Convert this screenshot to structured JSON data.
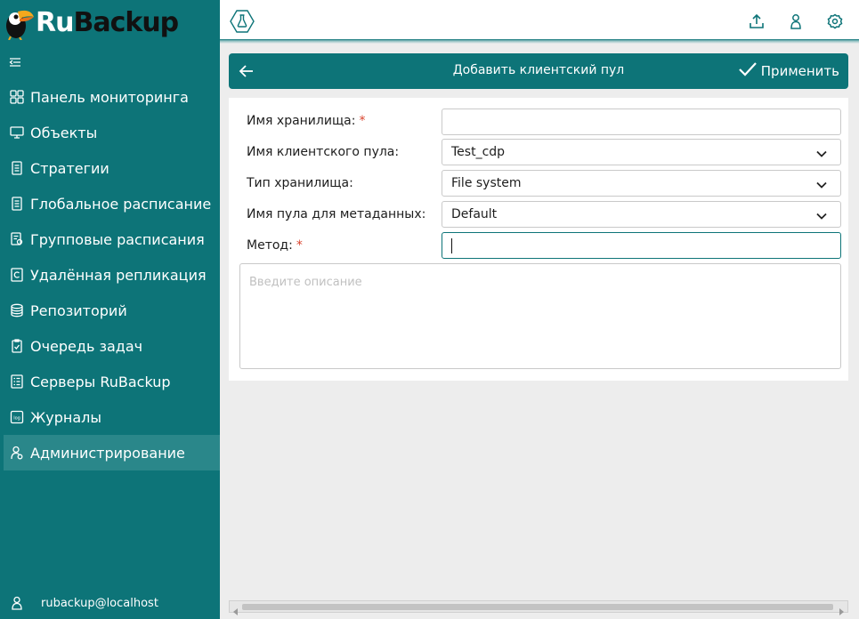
{
  "app": {
    "logo_part1": "Ru",
    "logo_part2": "Backup"
  },
  "colors": {
    "accent": "#0d7478",
    "sidebar_active": "#2a878a",
    "required": "#d9442e"
  },
  "sidebar": {
    "collapse_icon": "collapse-icon",
    "items": [
      {
        "label": "Панель мониторинга",
        "icon": "dashboard-icon",
        "active": false
      },
      {
        "label": "Объекты",
        "icon": "monitor-icon",
        "active": false
      },
      {
        "label": "Стратегии",
        "icon": "document-icon",
        "active": false
      },
      {
        "label": "Глобальное расписание",
        "icon": "document-icon",
        "active": false
      },
      {
        "label": "Групповые расписания",
        "icon": "group-schedule-icon",
        "active": false
      },
      {
        "label": "Удалённая репликация",
        "icon": "replication-icon",
        "active": false
      },
      {
        "label": "Репозиторий",
        "icon": "database-icon",
        "active": false
      },
      {
        "label": "Очередь задач",
        "icon": "task-queue-icon",
        "active": false
      },
      {
        "label": "Серверы RuBackup",
        "icon": "server-list-icon",
        "active": false
      },
      {
        "label": "Журналы",
        "icon": "log-icon",
        "active": false
      },
      {
        "label": "Администрирование",
        "icon": "admin-user-icon",
        "active": true
      }
    ],
    "user": "rubackup@localhost",
    "log_icon_text": "log"
  },
  "topbar": {
    "icons": [
      "lab-flask-icon",
      "upload-icon",
      "user-icon",
      "settings-icon"
    ]
  },
  "panel": {
    "title": "Добавить клиентский пул",
    "apply_label": "Применить"
  },
  "form": {
    "storage_name_label": "Имя хранилища:",
    "storage_name_value": "",
    "client_pool_label": "Имя клиентского пула:",
    "client_pool_value": "Test_cdp",
    "storage_type_label": "Тип хранилища:",
    "storage_type_value": "File system",
    "metadata_pool_label": "Имя пула для метаданных:",
    "metadata_pool_value": "Default",
    "method_label": "Метод:",
    "method_value": "",
    "required_mark": "*",
    "description_placeholder": "Введите описание"
  }
}
